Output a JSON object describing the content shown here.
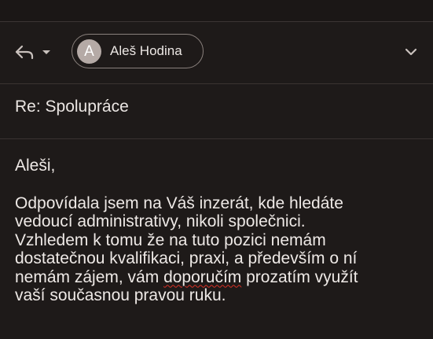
{
  "toolbar": {
    "reply_icon": "reply-icon",
    "dropdown_icon": "caret-down-icon",
    "recipient": {
      "avatar_letter": "A",
      "name": "Aleš Hodina"
    },
    "expand_icon": "chevron-down-icon"
  },
  "email": {
    "subject": "Re: Spolupráce",
    "greeting": "Aleši,",
    "lines": [
      "Odpovídala jsem na Váš inzerát, kde hledáte",
      "vedoucí administrativy, nikoli společnici.",
      "Vzhledem k tomu že na tuto pozici nemám",
      "dostatečnou kvalifikaci, praxi, a především o ní"
    ],
    "line5_before": "nemám zájem, vám ",
    "line5_misspelled": "doporučím",
    "line5_after": " prozatím využít",
    "line6": "vaší současnou pravou ruku."
  },
  "colors": {
    "background": "#1e1a19",
    "text": "#eee9e6",
    "chip_border": "#8a817d",
    "avatar": "#b5aaa6",
    "spellcheck": "#d93025"
  }
}
